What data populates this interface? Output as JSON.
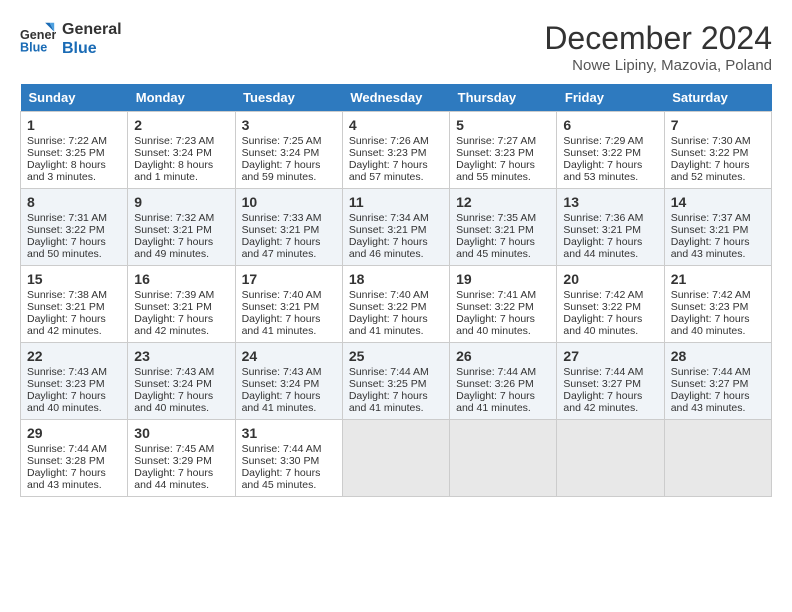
{
  "logo": {
    "line1": "General",
    "line2": "Blue"
  },
  "title": "December 2024",
  "location": "Nowe Lipiny, Mazovia, Poland",
  "days_of_week": [
    "Sunday",
    "Monday",
    "Tuesday",
    "Wednesday",
    "Thursday",
    "Friday",
    "Saturday"
  ],
  "weeks": [
    [
      {
        "day": 1,
        "rise": "7:22 AM",
        "set": "3:25 PM",
        "daylight": "8 hours and 3 minutes."
      },
      {
        "day": 2,
        "rise": "7:23 AM",
        "set": "3:24 PM",
        "daylight": "8 hours and 1 minute."
      },
      {
        "day": 3,
        "rise": "7:25 AM",
        "set": "3:24 PM",
        "daylight": "7 hours and 59 minutes."
      },
      {
        "day": 4,
        "rise": "7:26 AM",
        "set": "3:23 PM",
        "daylight": "7 hours and 57 minutes."
      },
      {
        "day": 5,
        "rise": "7:27 AM",
        "set": "3:23 PM",
        "daylight": "7 hours and 55 minutes."
      },
      {
        "day": 6,
        "rise": "7:29 AM",
        "set": "3:22 PM",
        "daylight": "7 hours and 53 minutes."
      },
      {
        "day": 7,
        "rise": "7:30 AM",
        "set": "3:22 PM",
        "daylight": "7 hours and 52 minutes."
      }
    ],
    [
      {
        "day": 8,
        "rise": "7:31 AM",
        "set": "3:22 PM",
        "daylight": "7 hours and 50 minutes."
      },
      {
        "day": 9,
        "rise": "7:32 AM",
        "set": "3:21 PM",
        "daylight": "7 hours and 49 minutes."
      },
      {
        "day": 10,
        "rise": "7:33 AM",
        "set": "3:21 PM",
        "daylight": "7 hours and 47 minutes."
      },
      {
        "day": 11,
        "rise": "7:34 AM",
        "set": "3:21 PM",
        "daylight": "7 hours and 46 minutes."
      },
      {
        "day": 12,
        "rise": "7:35 AM",
        "set": "3:21 PM",
        "daylight": "7 hours and 45 minutes."
      },
      {
        "day": 13,
        "rise": "7:36 AM",
        "set": "3:21 PM",
        "daylight": "7 hours and 44 minutes."
      },
      {
        "day": 14,
        "rise": "7:37 AM",
        "set": "3:21 PM",
        "daylight": "7 hours and 43 minutes."
      }
    ],
    [
      {
        "day": 15,
        "rise": "7:38 AM",
        "set": "3:21 PM",
        "daylight": "7 hours and 42 minutes."
      },
      {
        "day": 16,
        "rise": "7:39 AM",
        "set": "3:21 PM",
        "daylight": "7 hours and 42 minutes."
      },
      {
        "day": 17,
        "rise": "7:40 AM",
        "set": "3:21 PM",
        "daylight": "7 hours and 41 minutes."
      },
      {
        "day": 18,
        "rise": "7:40 AM",
        "set": "3:22 PM",
        "daylight": "7 hours and 41 minutes."
      },
      {
        "day": 19,
        "rise": "7:41 AM",
        "set": "3:22 PM",
        "daylight": "7 hours and 40 minutes."
      },
      {
        "day": 20,
        "rise": "7:42 AM",
        "set": "3:22 PM",
        "daylight": "7 hours and 40 minutes."
      },
      {
        "day": 21,
        "rise": "7:42 AM",
        "set": "3:23 PM",
        "daylight": "7 hours and 40 minutes."
      }
    ],
    [
      {
        "day": 22,
        "rise": "7:43 AM",
        "set": "3:23 PM",
        "daylight": "7 hours and 40 minutes."
      },
      {
        "day": 23,
        "rise": "7:43 AM",
        "set": "3:24 PM",
        "daylight": "7 hours and 40 minutes."
      },
      {
        "day": 24,
        "rise": "7:43 AM",
        "set": "3:24 PM",
        "daylight": "7 hours and 41 minutes."
      },
      {
        "day": 25,
        "rise": "7:44 AM",
        "set": "3:25 PM",
        "daylight": "7 hours and 41 minutes."
      },
      {
        "day": 26,
        "rise": "7:44 AM",
        "set": "3:26 PM",
        "daylight": "7 hours and 41 minutes."
      },
      {
        "day": 27,
        "rise": "7:44 AM",
        "set": "3:27 PM",
        "daylight": "7 hours and 42 minutes."
      },
      {
        "day": 28,
        "rise": "7:44 AM",
        "set": "3:27 PM",
        "daylight": "7 hours and 43 minutes."
      }
    ],
    [
      {
        "day": 29,
        "rise": "7:44 AM",
        "set": "3:28 PM",
        "daylight": "7 hours and 43 minutes."
      },
      {
        "day": 30,
        "rise": "7:45 AM",
        "set": "3:29 PM",
        "daylight": "7 hours and 44 minutes."
      },
      {
        "day": 31,
        "rise": "7:44 AM",
        "set": "3:30 PM",
        "daylight": "7 hours and 45 minutes."
      },
      null,
      null,
      null,
      null
    ]
  ]
}
